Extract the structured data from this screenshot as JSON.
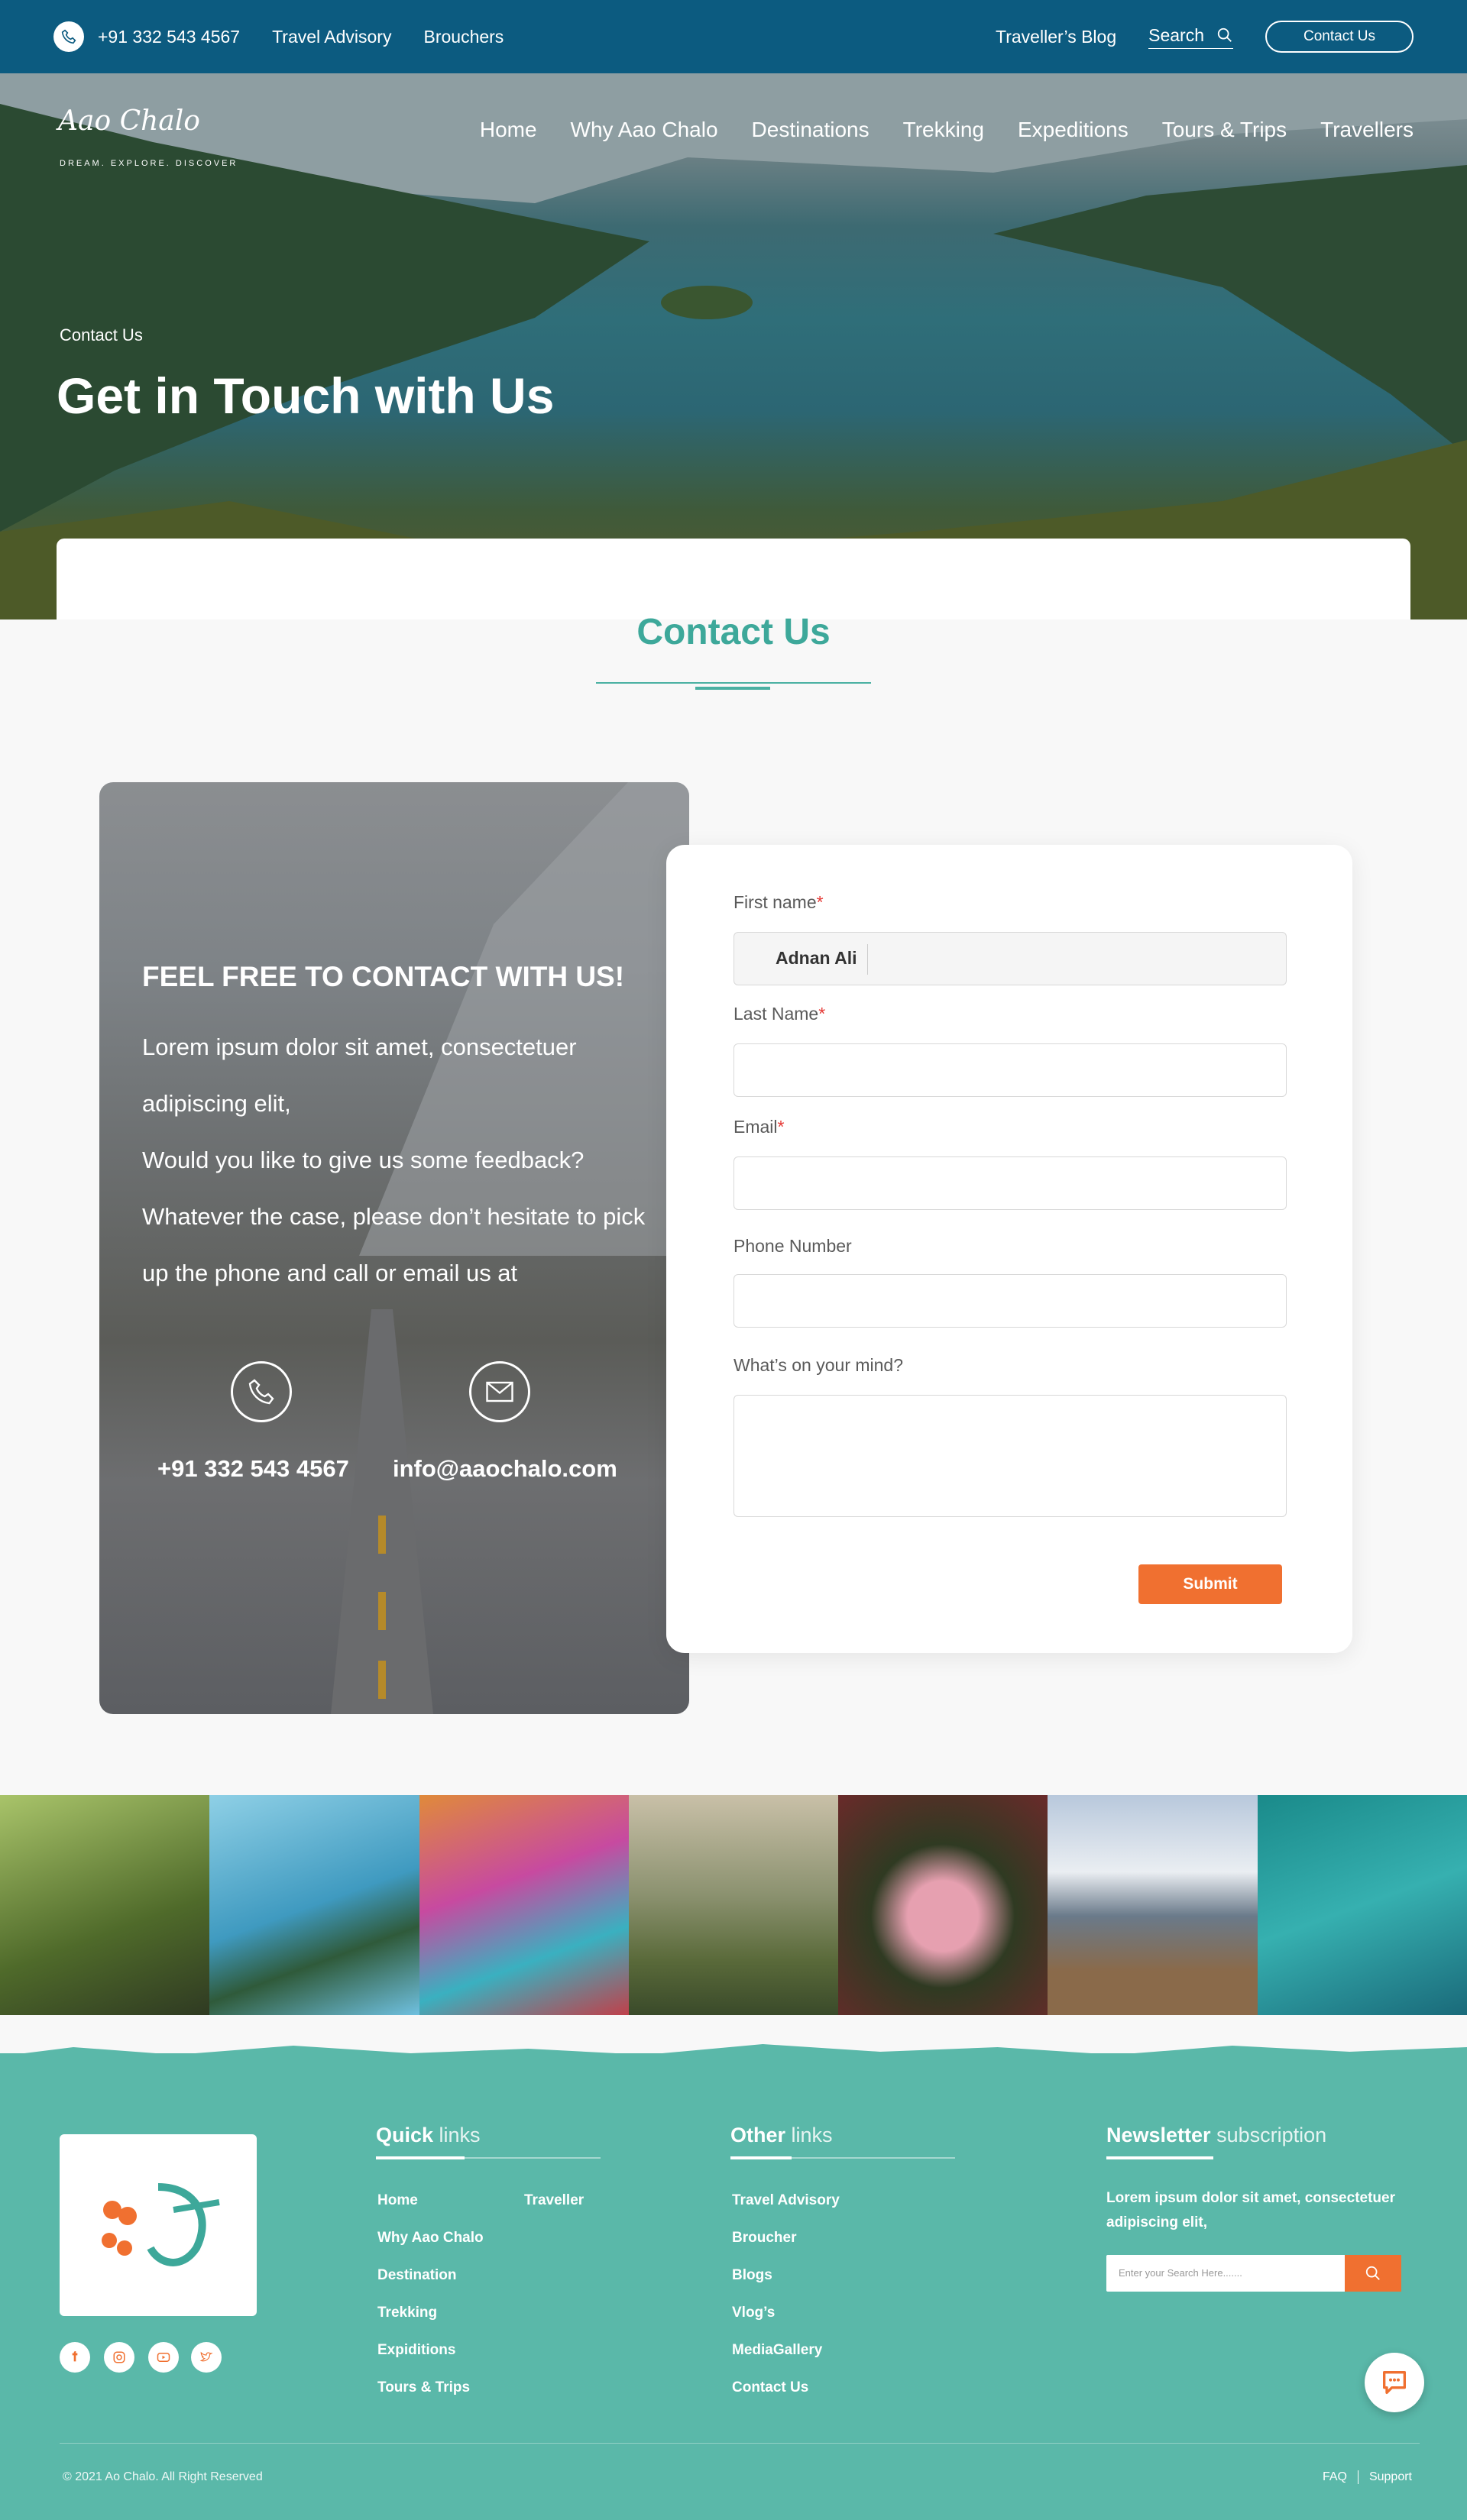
{
  "topbar": {
    "phone": "+91 332 543 4567",
    "links": [
      "Travel Advisory",
      "Brouchers"
    ],
    "blog": "Traveller’s Blog",
    "search": "Search",
    "contact_btn": "Contact Us"
  },
  "logo": {
    "text": "Aao Chalo",
    "tagline": "DREAM. EXPLORE. DISCOVER"
  },
  "nav": [
    "Home",
    "Why Aao Chalo",
    "Destinations",
    "Trekking",
    "Expeditions",
    "Tours & Trips",
    "Travellers"
  ],
  "hero": {
    "breadcrumb": "Contact Us",
    "title": "Get in Touch with Us"
  },
  "section": {
    "title": "Contact Us"
  },
  "panel": {
    "title": "FEEL FREE TO CONTACT WITH US!",
    "text1": "Lorem ipsum dolor sit amet, consectetuer adipiscing elit,",
    "text2": "Would you like to give us some feedback? Whatever the case, please don’t hesitate to pick up the phone and call or email us at",
    "phone": "+91 332 543 4567",
    "email": "info@aaochalo.com"
  },
  "form": {
    "first_name_label": "First name",
    "first_name_value": "Adnan Ali",
    "last_name_label": "Last Name",
    "email_label": "Email",
    "phone_label": "Phone Number",
    "mind_label": "What’s on your mind?",
    "required_mark": "*",
    "submit": "Submit"
  },
  "gallery_colors": [
    "#7c8a4a",
    "#5ca6c4",
    "#c45aa0",
    "#6f7a52",
    "#3d4a2a",
    "#8a9aa8",
    "#2f9a9a"
  ],
  "footer": {
    "quick_head_bold": "Quick",
    "quick_head_light": "links",
    "quick_links_col1": [
      "Home",
      "Why Aao Chalo",
      "Destination",
      "Trekking",
      "Expiditions",
      "Tours & Trips"
    ],
    "quick_links_col2": [
      "Traveller"
    ],
    "other_head_bold": "Other",
    "other_head_light": "links",
    "other_links": [
      "Travel Advisory",
      "Broucher",
      "Blogs",
      "Vlog’s",
      "MediaGallery",
      "Contact Us"
    ],
    "news_head_bold": "Newsletter",
    "news_head_light": "subscription",
    "news_text": "Lorem ipsum dolor sit amet, consectetuer adipiscing elit,",
    "news_placeholder": "Enter your Search Here.......",
    "copyright": "© 2021 Ao Chalo. All Right Reserved",
    "faq": "FAQ",
    "support": "Support"
  },
  "colors": {
    "topbar": "#0c5b80",
    "accent": "#3da89a",
    "footer": "#5ab8a9",
    "button": "#f07030"
  }
}
